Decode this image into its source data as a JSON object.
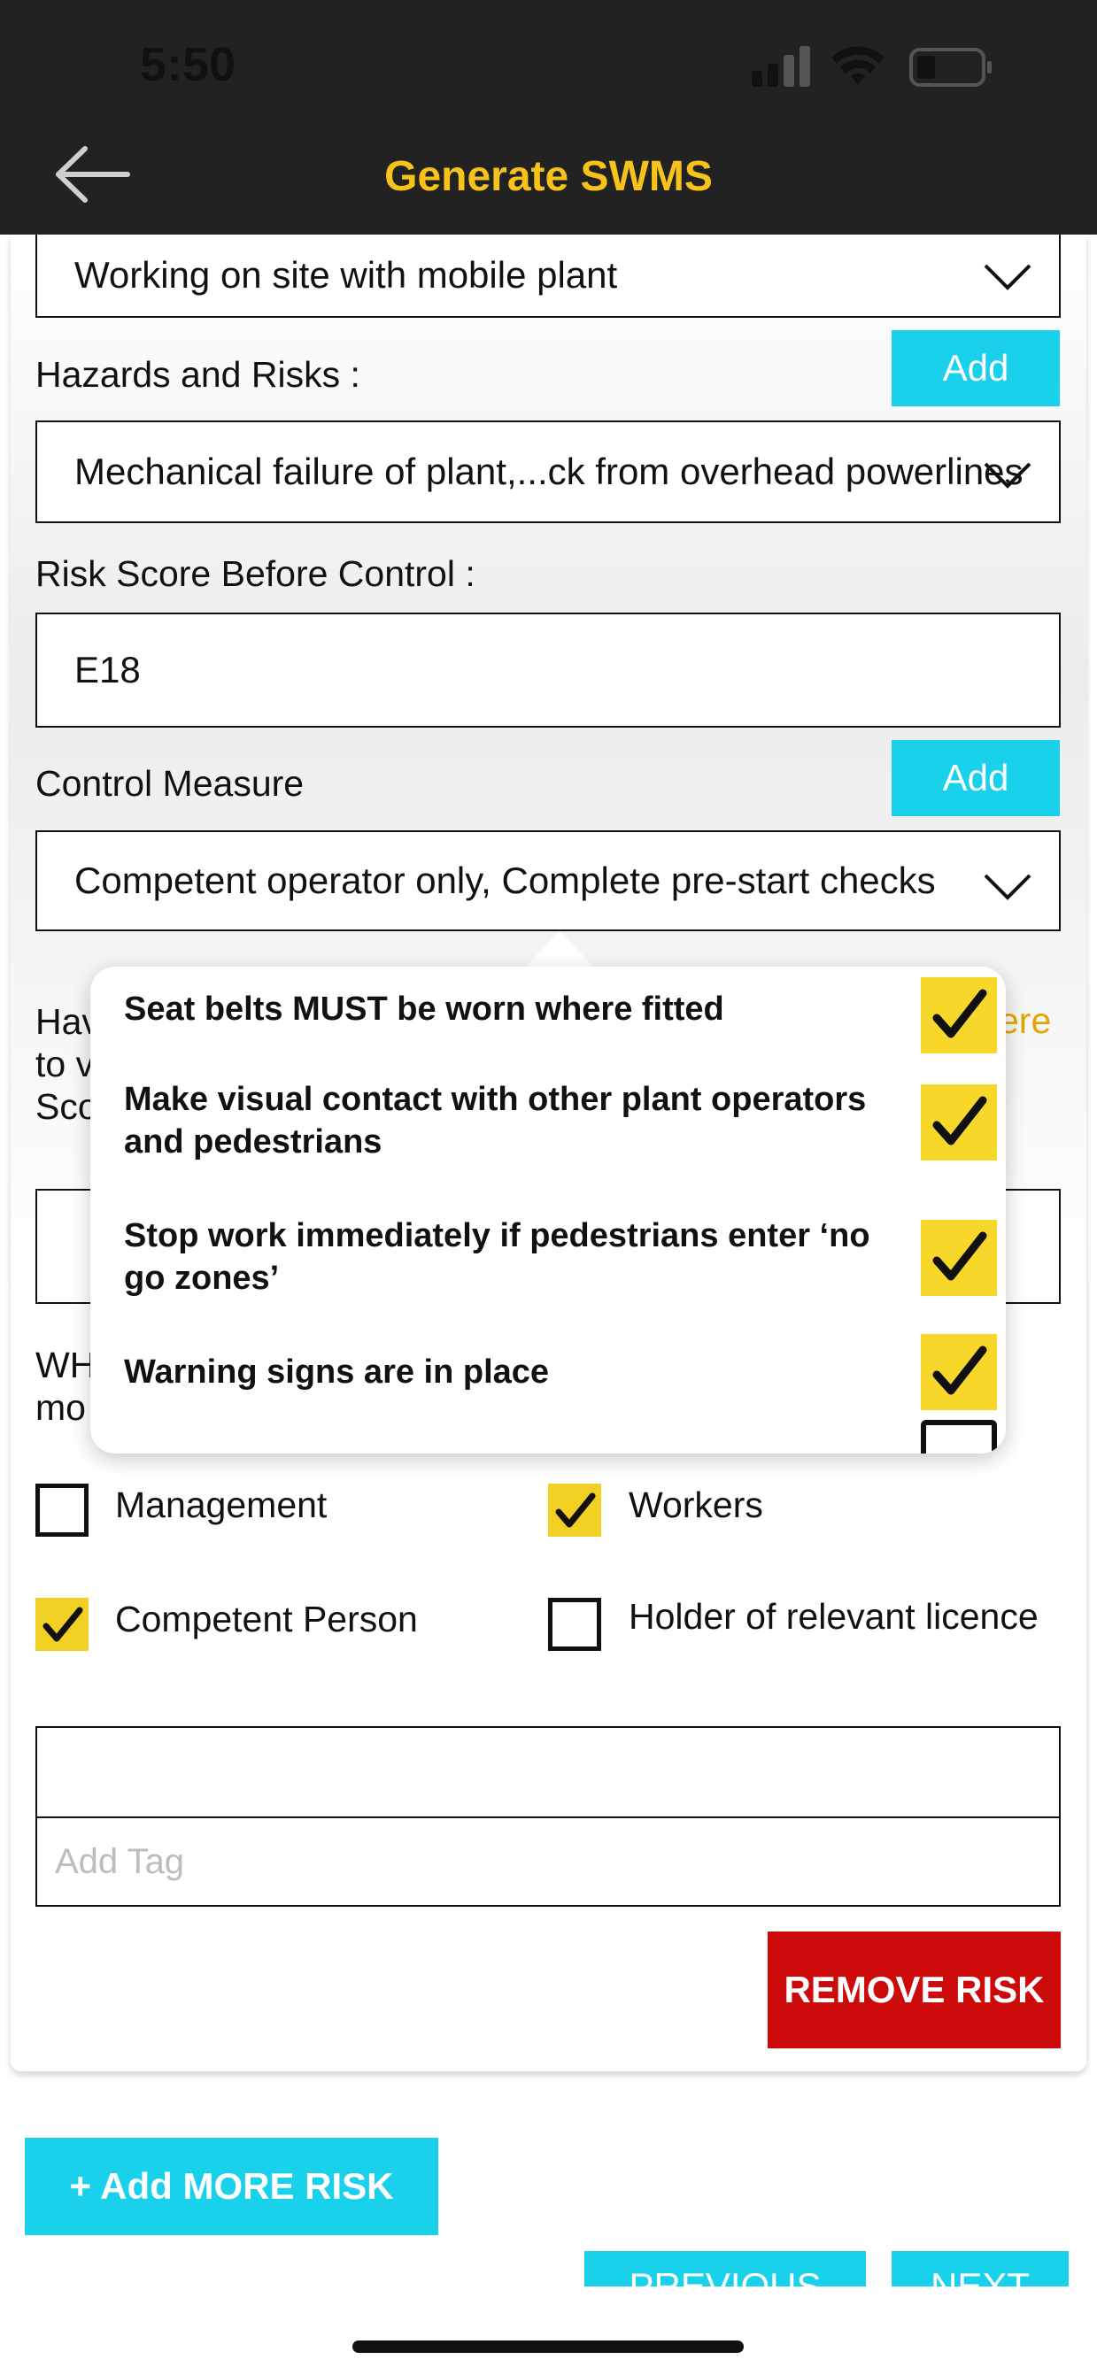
{
  "status_bar": {
    "time": "5:50",
    "icons": [
      "signal-icon",
      "wifi-icon",
      "battery-icon"
    ]
  },
  "header": {
    "title": "Generate SWMS",
    "back_icon": "arrow-left-icon"
  },
  "form": {
    "activity_value": "Working on site with mobile plant",
    "hazards_label": "Hazards and Risks :",
    "hazards_add": "Add",
    "hazards_value": "Mechanical failure of plant,...ck from overhead powerlines",
    "risk_before_label": "Risk Score Before Control :",
    "risk_before_value": "E18",
    "control_label": "Control Measure",
    "control_add": "Add",
    "control_value": "Competent operator only, Complete pre-start checks",
    "hidden_label_line1": "Hav",
    "hidden_label_line2": "to v",
    "hidden_label_line3": "Sco",
    "hidden_link_tail": "ere",
    "who_line1": "WH",
    "who_line2": "mo",
    "responsibles": [
      {
        "label": "Management",
        "checked": false
      },
      {
        "label": "Workers",
        "checked": true
      },
      {
        "label": "Competent Person",
        "checked": true
      },
      {
        "label": "Holder of relevant licence",
        "checked": false
      }
    ],
    "tag_placeholder": "Add Tag",
    "remove_label": "REMOVE RISK"
  },
  "popover": {
    "items": [
      {
        "label": "Seat belts MUST be worn where fitted",
        "checked": true
      },
      {
        "label": "Make visual contact with other plant operators and pedestrians",
        "checked": true
      },
      {
        "label": "Stop work immediately if pedestrians enter ‘no go zones’",
        "checked": true
      },
      {
        "label": "Warning signs are in place",
        "checked": true
      }
    ]
  },
  "footer": {
    "add_more_label": "+ Add MORE RISK",
    "previous_label": "PREVIOUS",
    "next_label": "NEXT"
  },
  "colors": {
    "accent_cyan": "#1ad1ec",
    "title_gold": "#f7c31a",
    "check_yellow": "#f2cf23",
    "remove_red": "#cc0a0a",
    "header_dark": "#222222"
  }
}
